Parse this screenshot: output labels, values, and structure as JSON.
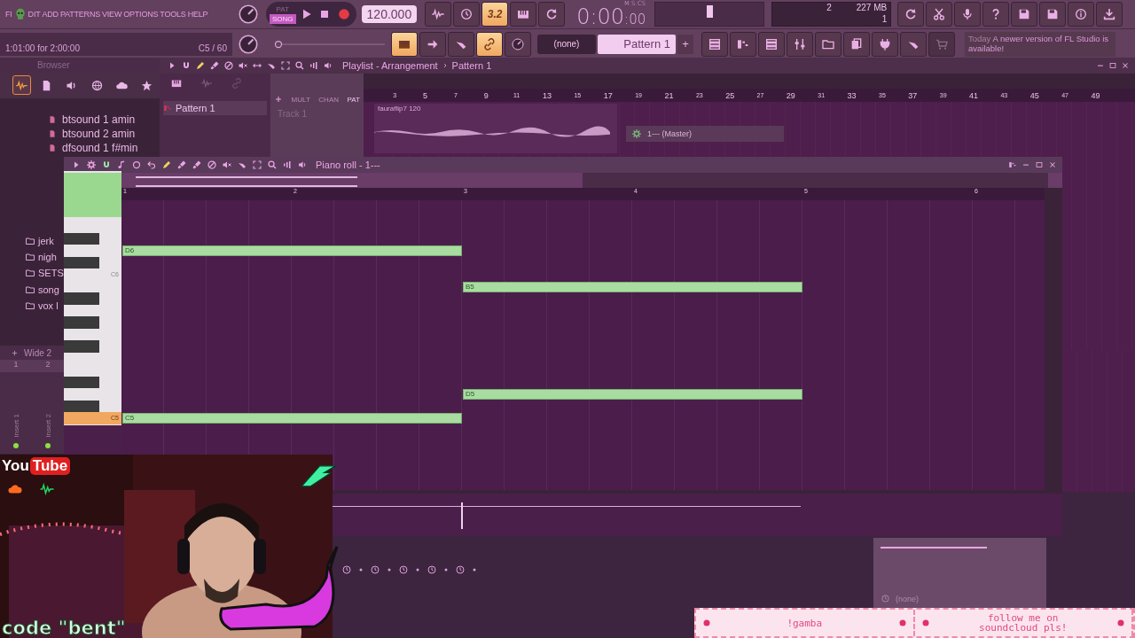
{
  "menu": {
    "items": [
      {
        "label": "FI"
      },
      {
        "label": "DIT"
      },
      {
        "label": "ADD"
      },
      {
        "label": "PATTERNS"
      },
      {
        "label": "VIEW"
      },
      {
        "label": "OPTIONS"
      },
      {
        "label": "TOOLS"
      },
      {
        "label": "HELP"
      }
    ]
  },
  "hint_bar": {
    "text": "1:01:00 for 2:00:00",
    "note": "C5 / 60"
  },
  "transport": {
    "modes": [
      {
        "label": "PAT",
        "selected": false
      },
      {
        "label": "SONG",
        "selected": true
      }
    ],
    "tempo": "120.000",
    "time": "0:00",
    "time_cs": ":00",
    "time_format": "M:S:CS"
  },
  "master_volume": {
    "level": 0.5
  },
  "master_pitch": {
    "level": 0
  },
  "toolbar_top": [
    {
      "on": false
    },
    {
      "on": false
    },
    {
      "on": true,
      "label": "3.2"
    },
    {
      "on": false
    },
    {
      "on": false
    }
  ],
  "cpu": {
    "voices": "2",
    "memory": "227 MB",
    "polyphony": "1"
  },
  "toolbar_right": [
    {
      "on": false
    },
    {
      "on": false
    },
    {
      "on": false
    },
    {
      "on": false
    },
    {
      "on": false
    },
    {
      "on": false
    },
    {
      "on": false
    },
    {
      "on": false
    }
  ],
  "toolbar_bottom": [
    {
      "on": true
    },
    {
      "on": false
    },
    {
      "on": false
    },
    {
      "on": true
    },
    {
      "on": false
    }
  ],
  "pattern_picker": {
    "channel": "(none)",
    "pattern": "Pattern 1",
    "add": "+"
  },
  "view_buttons": [
    {
      "disabled": false
    },
    {
      "disabled": false
    },
    {
      "disabled": false
    },
    {
      "disabled": false
    },
    {
      "disabled": false
    },
    {
      "disabled": false
    },
    {
      "disabled": false
    },
    {
      "disabled": false
    },
    {
      "disabled": true
    }
  ],
  "news": {
    "date": "Today",
    "message": "A newer version of FL Studio is available!"
  },
  "browser": {
    "title": "Browser",
    "tabs": [
      {
        "selected": true
      },
      {
        "selected": false
      },
      {
        "selected": false
      },
      {
        "selected": false
      },
      {
        "selected": false
      },
      {
        "selected": false
      }
    ],
    "files": [
      {
        "label": "btsound 1 amin"
      },
      {
        "label": "btsound 2 amin"
      },
      {
        "label": "dfsound 1 f#min"
      }
    ],
    "folders": [
      {
        "label": "jerk"
      },
      {
        "label": "nigh"
      },
      {
        "label": "SETS"
      },
      {
        "label": "song"
      },
      {
        "label": "vox l"
      }
    ]
  },
  "playlist": {
    "title": "Playlist - Arrangement",
    "pattern": "Pattern 1",
    "source_tabs": [
      {
        "label": "MULT",
        "selected": false
      },
      {
        "label": "CHAN",
        "selected": false
      },
      {
        "label": "PAT",
        "selected": true
      }
    ],
    "patterns": [
      {
        "label": "Pattern 1",
        "selected": true
      }
    ],
    "track": "Track 1",
    "ruler": [
      "3",
      "5",
      "7",
      "9",
      "11",
      "13",
      "15",
      "17",
      "19",
      "21",
      "23",
      "25",
      "27",
      "29",
      "31",
      "33",
      "35",
      "37",
      "39",
      "41",
      "43",
      "45",
      "47",
      "49"
    ],
    "clip": "fauraflip7 120",
    "mixer_hint": "1--- (Master)"
  },
  "piano_roll": {
    "title": "Piano roll - 1---",
    "ruler": [
      "1",
      "2",
      "3",
      "4",
      "5",
      "6"
    ],
    "keys": [
      {
        "label": "C6",
        "highlighted": false
      },
      {
        "label": "C5",
        "highlighted": true
      }
    ],
    "notes": [
      {
        "label": "D6"
      },
      {
        "label": "B5"
      },
      {
        "label": "D5"
      },
      {
        "label": "C5"
      }
    ]
  },
  "mixer": {
    "preset": "Wide 2",
    "columns": [
      "1",
      "2"
    ],
    "inserts": [
      {
        "label": "Insert 1",
        "active": true
      },
      {
        "label": "Insert 2",
        "active": true
      }
    ]
  },
  "plugin_panel": {
    "label": "(none)"
  },
  "overlay": {
    "webcam": {
      "kind": "picture"
    },
    "youtube": [
      "You",
      "Tube"
    ],
    "caption": "code \"bent\"",
    "banner": [
      {
        "text": "!gamba"
      },
      {
        "text": "follow me on soundcloud pls!"
      }
    ]
  }
}
